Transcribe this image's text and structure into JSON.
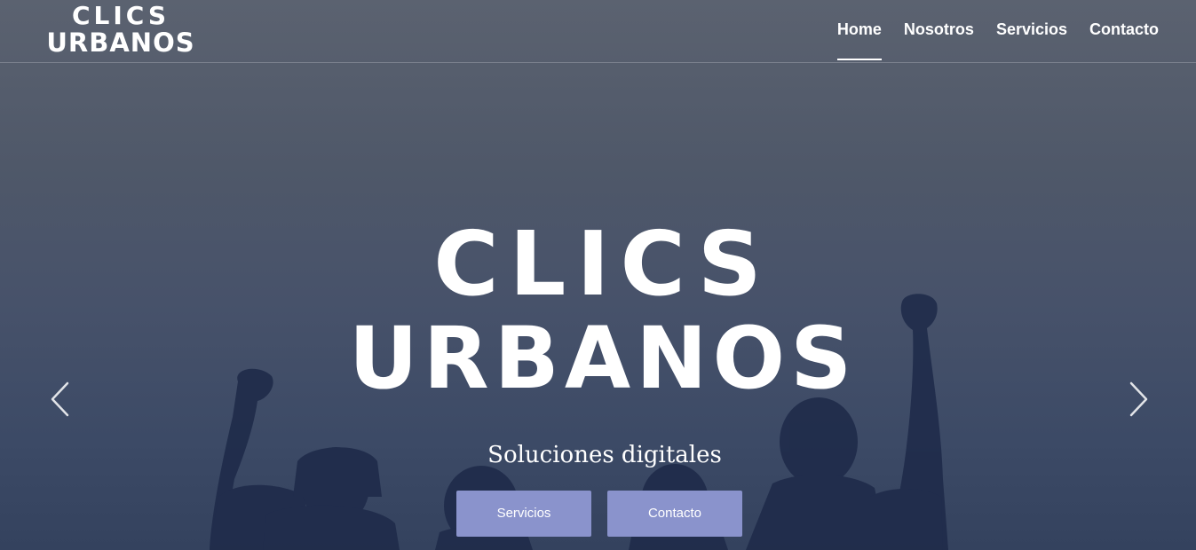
{
  "brand": {
    "logo_line1": "CLICS",
    "logo_line2": "URBANOS"
  },
  "nav": {
    "items": [
      {
        "label": "Home",
        "active": true
      },
      {
        "label": "Nosotros",
        "active": false
      },
      {
        "label": "Servicios",
        "active": false
      },
      {
        "label": "Contacto",
        "active": false
      }
    ]
  },
  "hero": {
    "title_line1": "CLICS",
    "title_line2": "URBANOS",
    "tagline": "Soluciones digitales",
    "buttons": {
      "servicios_label": "Servicios",
      "contacto_label": "Contacto"
    },
    "prev_icon": "chevron-left-icon",
    "next_icon": "chevron-right-icon"
  },
  "colors": {
    "button_bg": "#8a93cc",
    "overlay": "#4f5869",
    "silhouette": "#1e2a48"
  }
}
